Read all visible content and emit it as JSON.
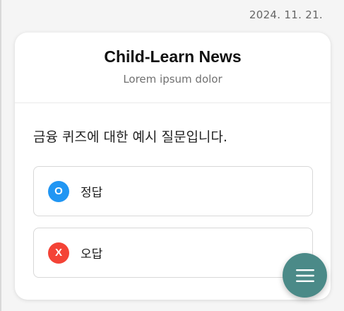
{
  "date": "2024. 11. 21.",
  "header": {
    "title": "Child-Learn News",
    "subtitle": "Lorem ipsum dolor"
  },
  "quiz": {
    "question": "금융 퀴즈에 대한 예시 질문입니다.",
    "options": [
      {
        "badge": "O",
        "label": "정답",
        "color": "#2196f3"
      },
      {
        "badge": "X",
        "label": "오답",
        "color": "#f44336"
      }
    ]
  },
  "fab": {
    "icon": "menu-icon",
    "color": "#4b8a88"
  }
}
